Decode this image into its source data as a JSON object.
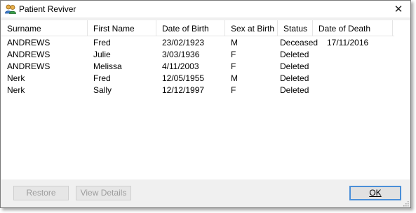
{
  "window": {
    "title": "Patient Reviver",
    "close_glyph": "✕"
  },
  "columns": [
    "Surname",
    "First Name",
    "Date of Birth",
    "Sex at Birth",
    "Status",
    "Date of Death"
  ],
  "rows": [
    [
      "ANDREWS",
      "Fred",
      "23/02/1923",
      "M",
      "Deceased",
      "17/11/2016"
    ],
    [
      "ANDREWS",
      "Julie",
      "3/03/1936",
      "F",
      "Deleted",
      ""
    ],
    [
      "ANDREWS",
      "Melissa",
      "4/11/2003",
      "F",
      "Deleted",
      ""
    ],
    [
      "Nerk",
      "Fred",
      "12/05/1955",
      "M",
      "Deleted",
      ""
    ],
    [
      "Nerk",
      "Sally",
      "12/12/1997",
      "F",
      "Deleted",
      ""
    ]
  ],
  "buttons": {
    "restore": "Restore",
    "view_details": "View Details",
    "ok": "OK"
  },
  "icons": {
    "app": "patients-icon",
    "close": "close-icon"
  },
  "colors": {
    "focus_border": "#4a8fd8",
    "disabled_text": "#9d9d9d"
  }
}
